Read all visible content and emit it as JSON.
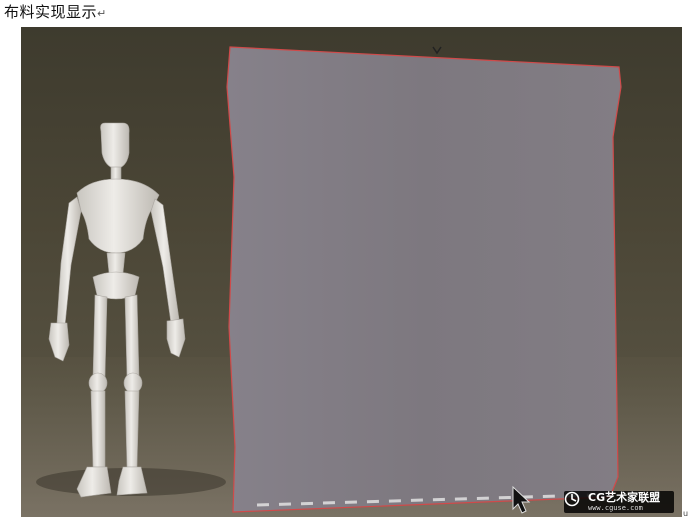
{
  "document": {
    "heading": "布料实现显示",
    "paragraph_mark": "↵"
  },
  "viewport": {
    "background_color": "#4b4636",
    "cloth_color": "#7e7a7c",
    "cloth_edge_color": "#d04a4a",
    "figure_color": "#e2e0dc"
  },
  "margin_mark": "u",
  "watermark": {
    "title": "CG艺术家联盟",
    "url": "www.cguse.com"
  },
  "icons": [
    "mouse-cursor-icon",
    "cg-logo-icon"
  ]
}
